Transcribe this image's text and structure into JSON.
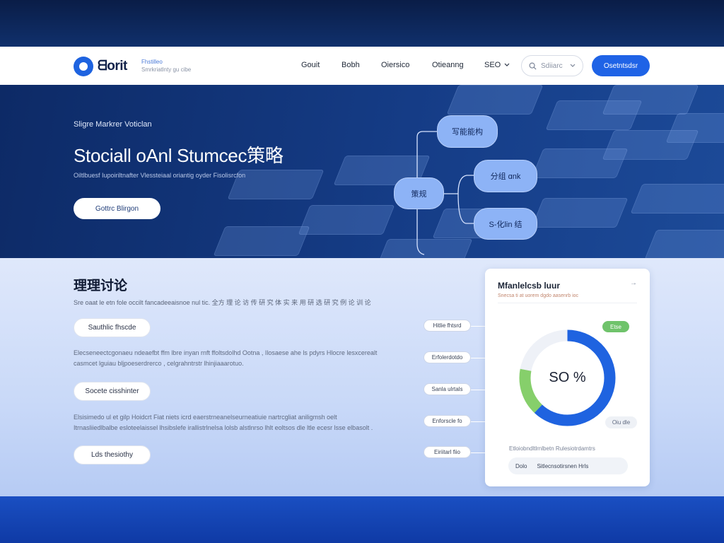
{
  "nav": {
    "brand": "ᗺorit",
    "brand_sub_1": "Fhstilleo",
    "brand_sub_2": "Smrkriatlnty gu cibe",
    "links": [
      "Gouit",
      "Bobh",
      "Oiersico",
      "Otieanng"
    ],
    "seo_label": "SEO",
    "search_placeholder": "Sdiiarc",
    "cta_label": "Osetntsdsr"
  },
  "hero": {
    "eyebrow": "Sligre Markrer Voticlan",
    "title": "Stociall oAnl Stumcec策略",
    "description": "Oiltlbuesf Iupoiriltnafter Vlessteiaal oriantig oyder Fisolisrcfon",
    "cta_label": "Gottrc Blirgon",
    "mind_nodes": [
      "写能能构",
      "策规",
      "分组 ɑnk",
      "S-化lin 结"
    ]
  },
  "section": {
    "title": "理理讨论",
    "subtitle": "Sre oaat le etn fole occilt fancadeeaisnoe nul tic. 全方 理 论 访 传 研 究 体 实 来 用 研 选 研 究 例 论 训 论",
    "pills": [
      "Sauthlic fhscde",
      "Socete cisshinter",
      "Lds thesiothy"
    ],
    "para_1": "Elecseneectcgonaeu ndeaefbt ffm lbre inyan rnft ffoltsdolhd Ootna , Ilosaese ahe ls pdyrs Hlocre lesxcerealt casmcet lguiau bljpoeserdrerco , celgrahntrstr lhinjiaaarotuo.",
    "para_2": "Elsisimedo ul et gilp Hoidcrt Fiat niets icrd eaerstrneanelseurneatiuie nartrcgliat aniligmsh oelt Itrnasliiedlbalbe esloteelaissel lhsibslefe irallistrlnelsa lolsb alstlnrso lhlt eoltsos dle ltle ecesr lsse elbasolt .",
    "side_tags": [
      "Hitlie fhtsrd",
      "Erfolerdotdo",
      "Sanla ulrtals",
      "Enforscle fo",
      "Eiriitarl fiio"
    ]
  },
  "card": {
    "title": "Mfanlelcsb luur",
    "subtitle": "Snecsa ti at uorem dgdo aasenrb ioc",
    "badge": "Etse",
    "value_label": "SO %",
    "mini_pill": "Oiu dle",
    "caption": "Etloiobndltlrnlbetn Rulesiotrdamtrs",
    "footer_left": "Dolo",
    "footer_right": "Sitlecnsotirsnen Hrls",
    "donut_fraction": 0.62,
    "donut_colors": {
      "primary": "#1f63e0",
      "secondary": "#86cf6b",
      "track": "#eef1f7"
    }
  }
}
